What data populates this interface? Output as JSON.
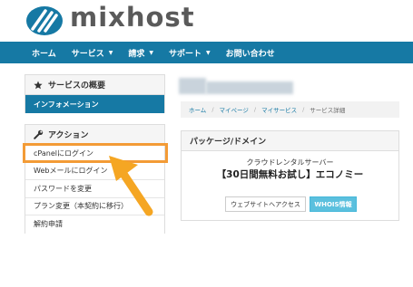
{
  "header": {
    "logo_text": "mixhost",
    "logo_color": "#5a5a5a",
    "logo_mark_color": "#1679a4"
  },
  "nav": {
    "items": [
      {
        "label": "ホーム",
        "has_caret": false
      },
      {
        "label": "サービス",
        "has_caret": true
      },
      {
        "label": "請求",
        "has_caret": true
      },
      {
        "label": "サポート",
        "has_caret": true
      },
      {
        "label": "お問い合わせ",
        "has_caret": false
      }
    ],
    "caret_glyph": "▼",
    "background": "#1679a4"
  },
  "sidebar": {
    "overview": {
      "title": "サービスの概要",
      "icon": "star-icon",
      "items": [
        {
          "label": "インフォメーション",
          "active": true
        }
      ]
    },
    "actions": {
      "title": "アクション",
      "icon": "wrench-icon",
      "items": [
        {
          "label": "cPanelにログイン",
          "highlighted": true
        },
        {
          "label": "Webメールにログイン"
        },
        {
          "label": "パスワードを変更"
        },
        {
          "label": "プラン変更（本契約に移行）"
        },
        {
          "label": "解約申請"
        }
      ]
    }
  },
  "breadcrumb": {
    "items": [
      "ホーム",
      "マイページ",
      "マイサービス"
    ],
    "current": "サービス詳細",
    "separator": "/"
  },
  "package": {
    "heading": "パッケージ/ドメイン",
    "product_group": "クラウドレンタルサーバー",
    "plan_name": "【30日間無料お試し】エコノミー",
    "visit_button": "ウェブサイトへアクセス",
    "whois_button": "WHOIS情報"
  },
  "annotation": {
    "highlight_color": "#f39b36",
    "arrow_color": "#f5a623"
  }
}
